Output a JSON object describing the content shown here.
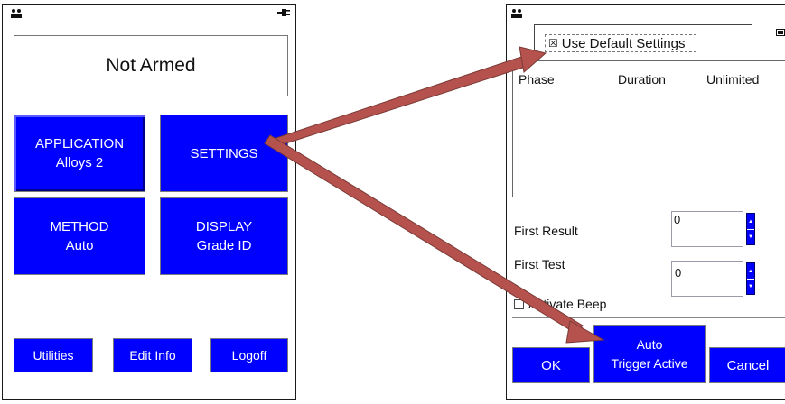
{
  "left": {
    "status": "Not Armed",
    "application": {
      "title": "APPLICATION",
      "value": "Alloys 2"
    },
    "settings": {
      "title": "SETTINGS"
    },
    "method": {
      "title": "METHOD",
      "value": "Auto"
    },
    "display": {
      "title": "DISPLAY",
      "value": "Grade ID"
    },
    "utilities": "Utilities",
    "edit_info": "Edit Info",
    "logoff": "Logoff"
  },
  "right": {
    "use_default": {
      "label": "Use Default Settings",
      "checked": true,
      "mark": "☒"
    },
    "table_headers": [
      "Phase",
      "Duration",
      "Unlimited"
    ],
    "first_result": {
      "label": "First Result",
      "value": "0"
    },
    "first_test": {
      "label": "First Test",
      "value": "0"
    },
    "activate_beep": {
      "label": "Activate Beep",
      "checked": false
    },
    "ok": "OK",
    "auto_trigger": {
      "line1": "Auto",
      "line2": "Trigger Active"
    },
    "cancel": "Cancel"
  },
  "icons": {
    "left_top": "user-icon",
    "left_power": "power-plug-icon",
    "right_top": "user-icon",
    "right_battery": "battery-icon"
  },
  "colors": {
    "button_blue": "#0000ff",
    "arrow_red": "#b5524e"
  }
}
